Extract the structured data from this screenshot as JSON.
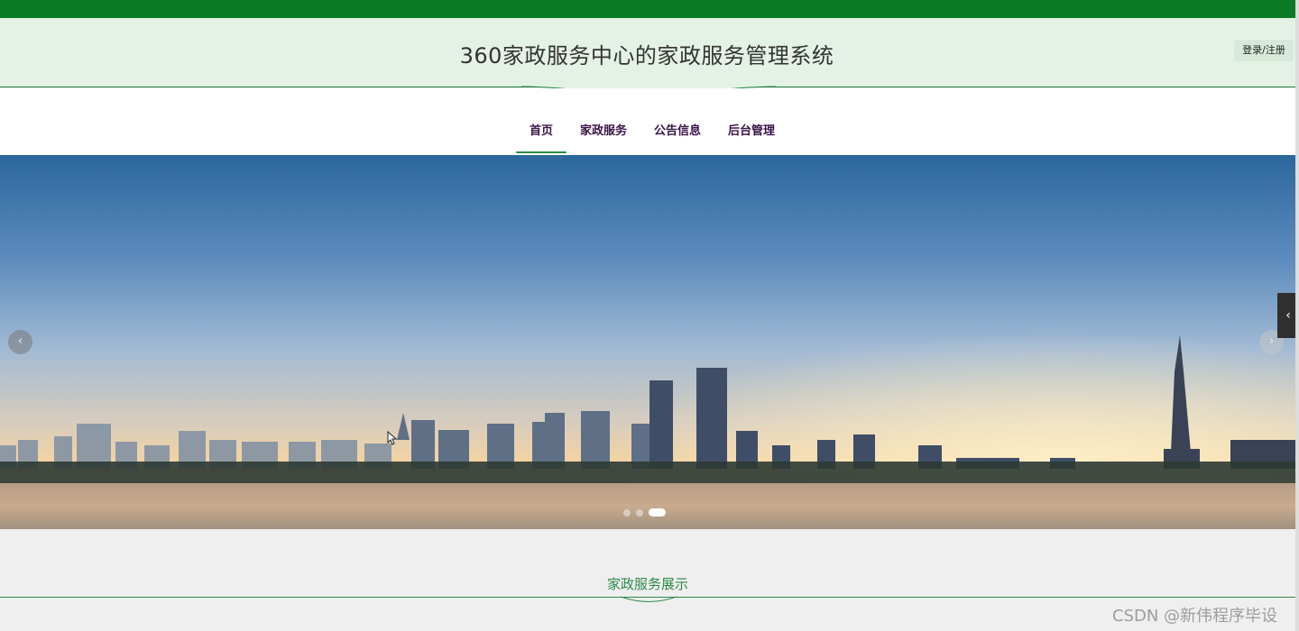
{
  "header": {
    "site_title": "360家政服务中心的家政服务管理系统",
    "login_label": "登录/注册"
  },
  "nav": {
    "items": [
      {
        "label": "首页",
        "active": true
      },
      {
        "label": "家政服务",
        "active": false
      },
      {
        "label": "公告信息",
        "active": false
      },
      {
        "label": "后台管理",
        "active": false
      }
    ]
  },
  "banner": {
    "prev_icon": "chevron-left-icon",
    "next_icon": "chevron-right-icon",
    "slide_count": 3,
    "active_slide": 3
  },
  "section": {
    "title": "家政服务展示"
  },
  "watermark": {
    "text": "CSDN @新伟程序毕设"
  },
  "colors": {
    "brand_green": "#0a7a25",
    "header_bg": "#e3f2e4",
    "nav_text": "#3b1448",
    "accent": "#2b8a48"
  }
}
